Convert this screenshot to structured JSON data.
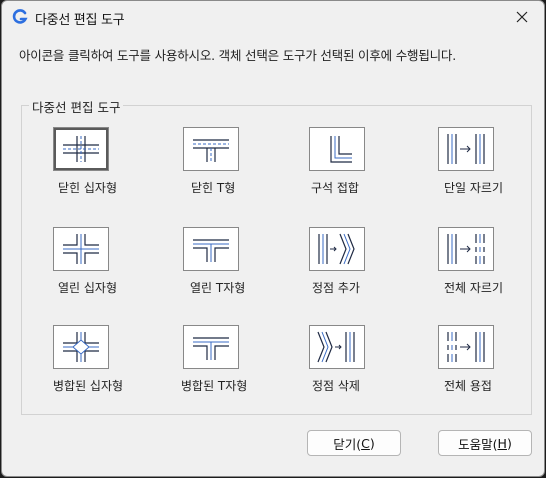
{
  "dialog": {
    "title": "다중선 편집 도구",
    "instruction": "아이콘을 클릭하여 도구를 사용하시오. 객체 선택은 도구가 선택된 이후에 수행됩니다.",
    "group_label": "다중선 편집 도구"
  },
  "tools": [
    {
      "label": "닫힌 십자형",
      "icon": "closed-cross-icon",
      "selected": true
    },
    {
      "label": "닫힌 T형",
      "icon": "closed-tee-icon"
    },
    {
      "label": "구석 접합",
      "icon": "corner-joint-icon"
    },
    {
      "label": "단일 자르기",
      "icon": "cut-single-icon"
    },
    {
      "label": "열린 십자형",
      "icon": "open-cross-icon"
    },
    {
      "label": "열린 T자형",
      "icon": "open-tee-icon"
    },
    {
      "label": "정점 추가",
      "icon": "add-vertex-icon"
    },
    {
      "label": "전체 자르기",
      "icon": "cut-all-icon"
    },
    {
      "label": "병합된 십자형",
      "icon": "merged-cross-icon"
    },
    {
      "label": "병합된 T자형",
      "icon": "merged-tee-icon"
    },
    {
      "label": "정점 삭제",
      "icon": "delete-vertex-icon"
    },
    {
      "label": "전체 용접",
      "icon": "weld-all-icon"
    }
  ],
  "buttons": {
    "close_label": "닫기(",
    "close_key": "C",
    "close_suffix": ")",
    "help_label": "도움말(",
    "help_key": "H",
    "help_suffix": ")"
  },
  "colors": {
    "line_dark": "#1f2a44",
    "line_blue": "#3a6bc4"
  }
}
